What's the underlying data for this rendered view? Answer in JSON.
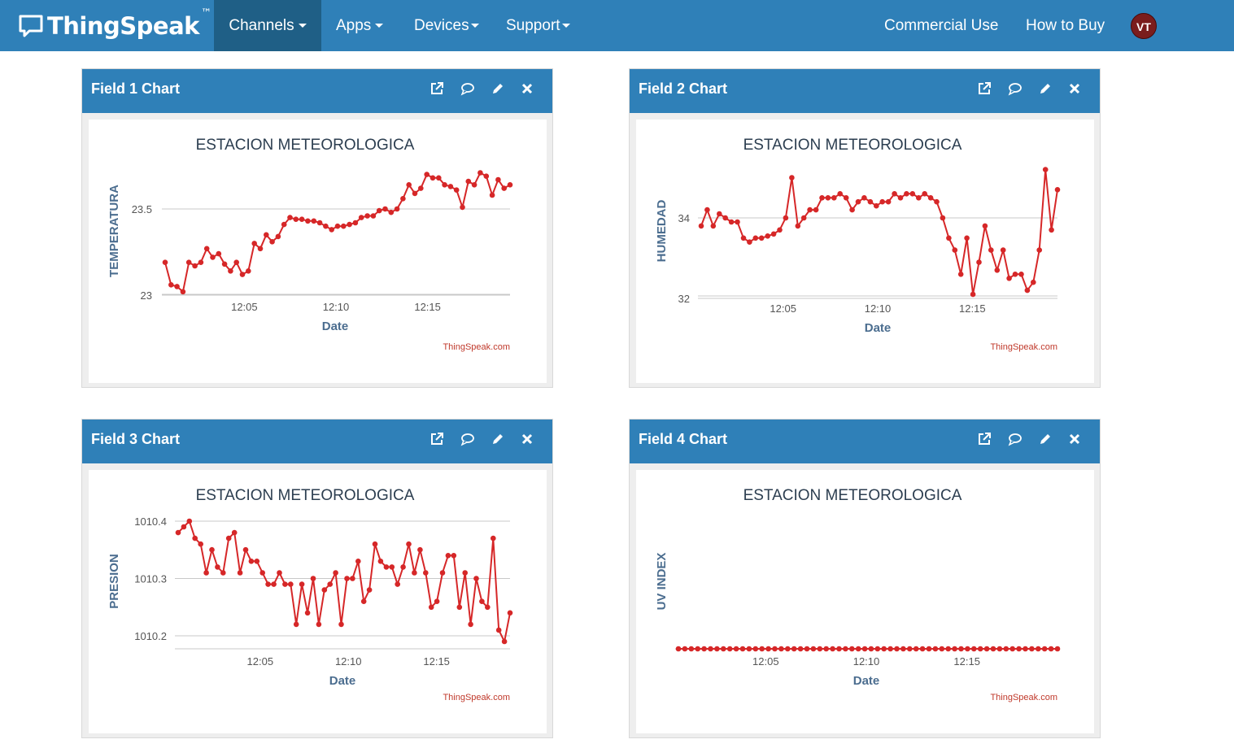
{
  "navbar": {
    "brand": "ThingSpeak",
    "brand_tm": "™",
    "items": [
      {
        "label": "Channels",
        "active": true
      },
      {
        "label": "Apps"
      },
      {
        "label": "Devices"
      },
      {
        "label": "Support"
      }
    ],
    "right_links": [
      "Commercial Use",
      "How to Buy"
    ],
    "avatar_initials": "VT",
    "colors": {
      "bar": "#2f80b8",
      "active": "#1f5f86",
      "avatar": "#7a1d1d"
    }
  },
  "panels": [
    {
      "title": "Field 1 Chart",
      "icons": [
        "external-link-icon",
        "comment-icon",
        "pencil-icon",
        "close-icon"
      ]
    },
    {
      "title": "Field 2 Chart",
      "icons": [
        "external-link-icon",
        "comment-icon",
        "pencil-icon",
        "close-icon"
      ]
    },
    {
      "title": "Field 3 Chart",
      "icons": [
        "external-link-icon",
        "comment-icon",
        "pencil-icon",
        "close-icon"
      ]
    },
    {
      "title": "Field 4 Chart",
      "icons": [
        "external-link-icon",
        "comment-icon",
        "pencil-icon",
        "close-icon"
      ]
    }
  ],
  "chart_data": [
    {
      "type": "line",
      "title": "ESTACION METEOROLOGICA",
      "xlabel": "Date",
      "ylabel": "TEMPERATURA",
      "credit": "ThingSpeak.com",
      "color": "#d62728",
      "x_ticks": [
        "12:05",
        "12:10",
        "12:15"
      ],
      "y_ticks": [
        "23",
        "23.5"
      ],
      "xlim": [
        "12:00:30",
        "12:19:30"
      ],
      "ylim": [
        22.98,
        23.68
      ],
      "grid": "y",
      "series": [
        {
          "values": [
            23.19,
            23.06,
            23.05,
            23.02,
            23.19,
            23.17,
            23.19,
            23.27,
            23.22,
            23.24,
            23.18,
            23.14,
            23.19,
            23.12,
            23.14,
            23.3,
            23.27,
            23.35,
            23.31,
            23.34,
            23.41,
            23.45,
            23.44,
            23.44,
            23.43,
            23.43,
            23.42,
            23.4,
            23.38,
            23.4,
            23.4,
            23.41,
            23.42,
            23.45,
            23.46,
            23.46,
            23.49,
            23.5,
            23.48,
            23.5,
            23.56,
            23.64,
            23.59,
            23.62,
            23.7,
            23.68,
            23.68,
            23.64,
            23.63,
            23.61,
            23.51,
            23.66,
            23.64,
            23.71,
            23.69,
            23.58,
            23.67,
            23.62,
            23.64
          ]
        }
      ]
    },
    {
      "type": "line",
      "title": "ESTACION METEOROLOGICA",
      "xlabel": "Date",
      "ylabel": "HUMEDAD",
      "credit": "ThingSpeak.com",
      "color": "#d62728",
      "x_ticks": [
        "12:05",
        "12:10",
        "12:15"
      ],
      "y_ticks": [
        "32",
        "34"
      ],
      "xlim": [
        "12:00:30",
        "12:19:30"
      ],
      "ylim": [
        31.9,
        35.3
      ],
      "grid": "y",
      "series": [
        {
          "values": [
            33.8,
            34.2,
            33.8,
            34.1,
            34.0,
            33.9,
            33.9,
            33.5,
            33.4,
            33.5,
            33.5,
            33.55,
            33.6,
            33.7,
            34.0,
            35.0,
            33.8,
            34.0,
            34.2,
            34.2,
            34.5,
            34.5,
            34.5,
            34.6,
            34.5,
            34.2,
            34.4,
            34.5,
            34.4,
            34.3,
            34.4,
            34.4,
            34.6,
            34.5,
            34.6,
            34.6,
            34.5,
            34.6,
            34.5,
            34.4,
            34.0,
            33.5,
            33.2,
            32.6,
            33.5,
            32.1,
            32.9,
            33.8,
            33.2,
            32.7,
            33.2,
            32.5,
            32.6,
            32.6,
            32.2,
            32.4,
            33.2,
            35.2,
            33.7,
            34.7
          ]
        }
      ]
    },
    {
      "type": "line",
      "title": "ESTACION METEOROLOGICA",
      "xlabel": "Date",
      "ylabel": "PRESION",
      "credit": "ThingSpeak.com",
      "color": "#d62728",
      "x_ticks": [
        "12:05",
        "12:10",
        "12:15"
      ],
      "y_ticks": [
        "1010.2",
        "1010.3",
        "1010.4"
      ],
      "xlim": [
        "12:00:10",
        "12:19:10"
      ],
      "ylim": [
        1010.176,
        1010.4
      ],
      "grid": "y",
      "series": [
        {
          "values": [
            1010.38,
            1010.39,
            1010.4,
            1010.37,
            1010.36,
            1010.31,
            1010.35,
            1010.32,
            1010.31,
            1010.37,
            1010.38,
            1010.31,
            1010.35,
            1010.33,
            1010.33,
            1010.31,
            1010.29,
            1010.29,
            1010.31,
            1010.29,
            1010.29,
            1010.22,
            1010.29,
            1010.24,
            1010.3,
            1010.22,
            1010.28,
            1010.29,
            1010.31,
            1010.22,
            1010.3,
            1010.3,
            1010.33,
            1010.26,
            1010.28,
            1010.36,
            1010.33,
            1010.32,
            1010.32,
            1010.29,
            1010.32,
            1010.36,
            1010.31,
            1010.35,
            1010.31,
            1010.25,
            1010.26,
            1010.31,
            1010.34,
            1010.34,
            1010.25,
            1010.31,
            1010.22,
            1010.3,
            1010.26,
            1010.25,
            1010.37,
            1010.21,
            1010.19,
            1010.24
          ]
        }
      ]
    },
    {
      "type": "scatter",
      "title": "ESTACION METEOROLOGICA",
      "xlabel": "Date",
      "ylabel": "UV INDEX",
      "credit": "ThingSpeak.com",
      "color": "#d62728",
      "x_ticks": [
        "12:05",
        "12:10",
        "12:15"
      ],
      "y_ticks": [],
      "xlim": [
        "12:00:30",
        "12:19:30"
      ],
      "ylim": [
        0,
        1
      ],
      "grid": "none",
      "series": [
        {
          "values": [
            0,
            0,
            0,
            0,
            0,
            0,
            0,
            0,
            0,
            0,
            0,
            0,
            0,
            0,
            0,
            0,
            0,
            0,
            0,
            0,
            0,
            0,
            0,
            0,
            0,
            0,
            0,
            0,
            0,
            0,
            0,
            0,
            0,
            0,
            0,
            0,
            0,
            0,
            0,
            0,
            0,
            0,
            0,
            0,
            0,
            0,
            0,
            0,
            0,
            0,
            0,
            0,
            0,
            0,
            0,
            0,
            0,
            0,
            0,
            0
          ]
        }
      ]
    }
  ]
}
